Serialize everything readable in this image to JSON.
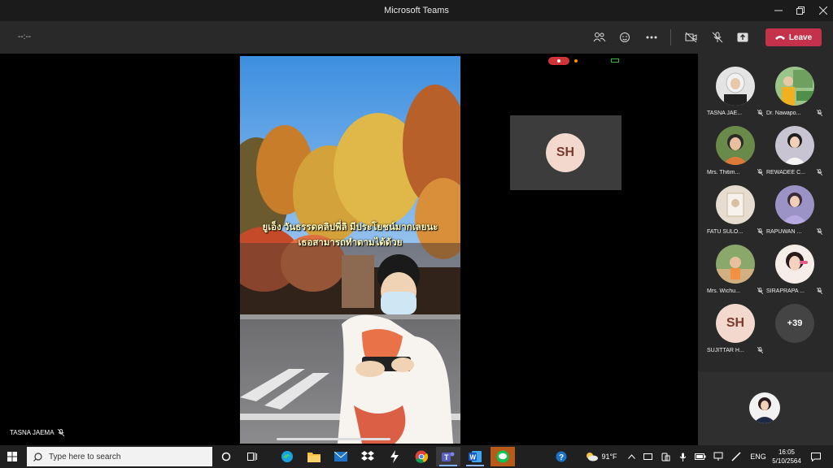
{
  "window": {
    "title": "Microsoft Teams"
  },
  "toolbar": {
    "timer": "--:--",
    "leave_label": "Leave"
  },
  "stage": {
    "caption_line1": "ยูเอ็ง วันธรรดคลิปพี่ลิ มีประโยชน์มากเลยนะ",
    "caption_line2": "เธอสามารถทำตามได้ด้วย",
    "sh_initials": "SH",
    "speaker_name": "TASNA JAEMA"
  },
  "participants": [
    {
      "name": "TASNA JAE...",
      "avatar_color": "#d9d9d9"
    },
    {
      "name": "Dr. Nawapo...",
      "avatar_color": "#9ac48a"
    },
    {
      "name": "Mrs. Thitim...",
      "avatar_color": "#e07a3a"
    },
    {
      "name": "REWADEE C...",
      "avatar_color": "#b9b6c8"
    },
    {
      "name": "FATU SULO...",
      "avatar_color": "#d8c9b0"
    },
    {
      "name": "RAPUWAN ...",
      "avatar_color": "#8a7fb8"
    },
    {
      "name": "Mrs. Wichu...",
      "avatar_color": "#a0b070"
    },
    {
      "name": "SIRAPRAPA ...",
      "avatar_color": "#f2c7c0"
    },
    {
      "name": "SUJITTAR H...",
      "initials": "SH"
    }
  ],
  "more_count": "+39",
  "taskbar": {
    "search_placeholder": "Type here to search",
    "weather": "91°F",
    "language": "ENG",
    "time": "16:05",
    "date": "5/10/2564"
  }
}
